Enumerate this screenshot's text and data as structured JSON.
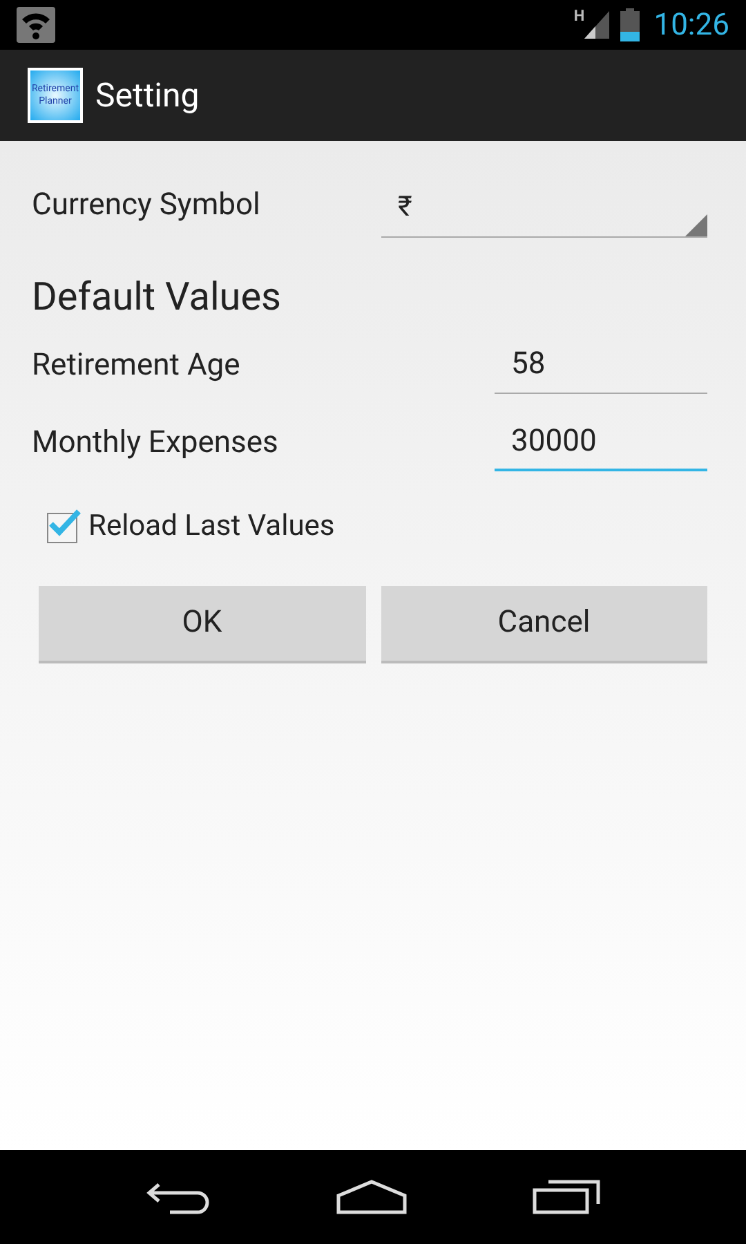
{
  "status_bar": {
    "network": "H",
    "time": "10:26"
  },
  "action_bar": {
    "icon_text": "Retirement Planner",
    "title": "Setting"
  },
  "currency": {
    "label": "Currency Symbol",
    "value": "₹"
  },
  "section_title": "Default Values",
  "fields": [
    {
      "label": "Retirement Age",
      "value": "58",
      "focused": false
    },
    {
      "label": "Monthly Expenses",
      "value": "30000",
      "focused": true
    }
  ],
  "reload": {
    "label": "Reload Last Values",
    "checked": true
  },
  "buttons": [
    "OK",
    "Cancel"
  ]
}
